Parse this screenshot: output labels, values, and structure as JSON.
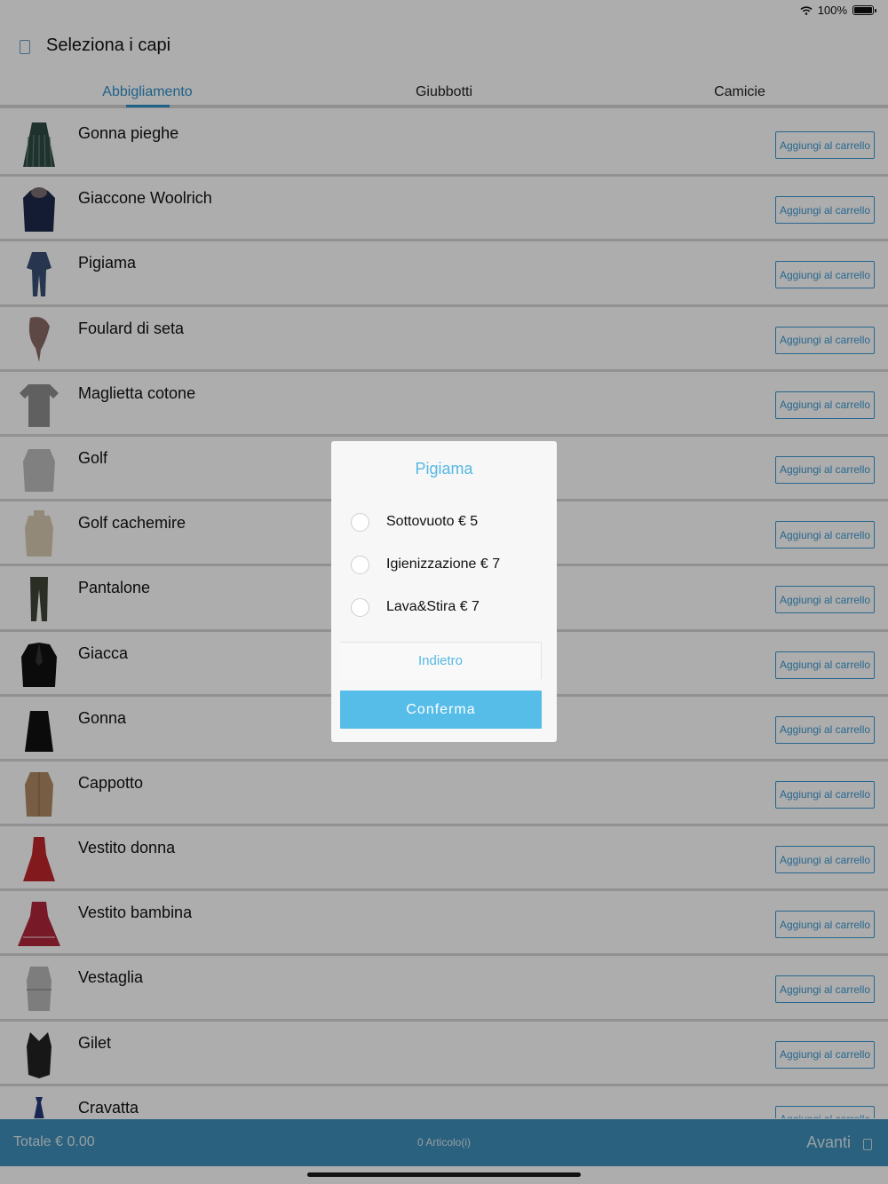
{
  "status": {
    "battery": "100%"
  },
  "header": {
    "title": "Seleziona i capi"
  },
  "tabs": [
    {
      "label": "Abbigliamento",
      "active": true
    },
    {
      "label": "Giubbotti",
      "active": false
    },
    {
      "label": "Camicie",
      "active": false
    }
  ],
  "add_label": "Aggiungi al carrello",
  "items": [
    {
      "name": "Gonna pieghe",
      "icon": "pleated-skirt-icon",
      "color": "#2e4a44"
    },
    {
      "name": "Giaccone Woolrich",
      "icon": "parka-jacket-icon",
      "color": "#1d2a4a"
    },
    {
      "name": "Pigiama",
      "icon": "pajama-icon",
      "color": "#3a4f73"
    },
    {
      "name": "Foulard di seta",
      "icon": "silk-scarf-icon",
      "color": "#8a6a66"
    },
    {
      "name": "Maglietta cotone",
      "icon": "tshirt-icon",
      "color": "#8e8e8e"
    },
    {
      "name": "Golf",
      "icon": "sweater-icon",
      "color": "#bdbdbd"
    },
    {
      "name": "Golf cachemire",
      "icon": "turtleneck-sweater-icon",
      "color": "#d9cbb1"
    },
    {
      "name": "Pantalone",
      "icon": "trousers-icon",
      "color": "#3e4535"
    },
    {
      "name": "Giacca",
      "icon": "blazer-icon",
      "color": "#111111"
    },
    {
      "name": "Gonna",
      "icon": "skirt-icon",
      "color": "#111111"
    },
    {
      "name": "Cappotto",
      "icon": "trench-coat-icon",
      "color": "#b08a63"
    },
    {
      "name": "Vestito donna",
      "icon": "dress-icon",
      "color": "#c0262b"
    },
    {
      "name": "Vestito bambina",
      "icon": "girl-dress-icon",
      "color": "#b2263a"
    },
    {
      "name": "Vestaglia",
      "icon": "robe-icon",
      "color": "#b9b9b9"
    },
    {
      "name": "Gilet",
      "icon": "vest-icon",
      "color": "#222222"
    },
    {
      "name": "Cravatta",
      "icon": "tie-icon",
      "color": "#1f3a7a"
    }
  ],
  "dialog": {
    "title": "Pigiama",
    "options": [
      {
        "label": "Sottovuoto € 5"
      },
      {
        "label": "Igienizzazione € 7"
      },
      {
        "label": "Lava&Stira € 7"
      }
    ],
    "back_label": "Indietro",
    "confirm_label": "Conferma"
  },
  "footer": {
    "total": "Totale € 0.00",
    "count": "0 Articolo(i)",
    "next": "Avanti"
  },
  "colors": {
    "accent": "#2f8fc8",
    "footer": "#3d90bb",
    "dialog_accent": "#56bde8"
  }
}
